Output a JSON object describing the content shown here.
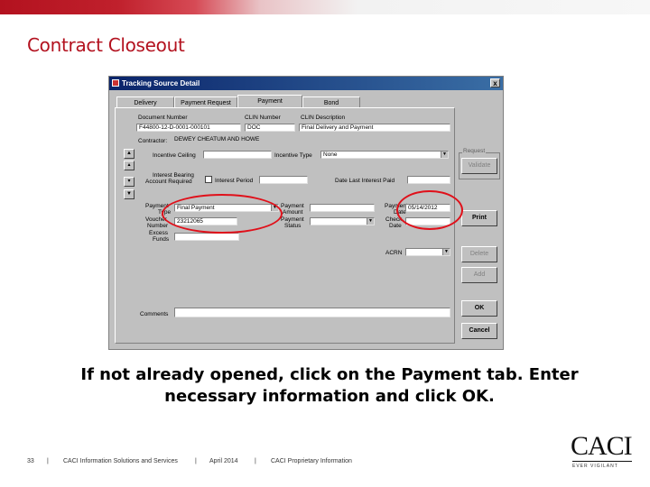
{
  "slide": {
    "title": "Contract Closeout",
    "caption_line1": "If not already opened, click on the Payment tab.  Enter",
    "caption_line2": "necessary information and click OK."
  },
  "footer": {
    "page": "33",
    "sep": "|",
    "company": "CACI Information Solutions and Services",
    "date": "April 2014",
    "notice": "CACI Proprietary Information"
  },
  "logo": {
    "text": "CACI",
    "tagline": "EVER VIGILANT"
  },
  "window": {
    "title": "Tracking Source Detail",
    "close": "x",
    "tabs": [
      "Delivery",
      "Payment Request",
      "Payment",
      "Bond"
    ],
    "active_tab": "Payment"
  },
  "form": {
    "document_number_label": "Document Number",
    "document_number": "F44800-12-D-0001-000101",
    "clin_number_label": "CLIN Number",
    "clin_number": "DOC",
    "clin_description_label": "CLIN Description",
    "clin_description": "Final Delivery and Payment",
    "contractor_label": "Contractor:",
    "contractor": "DEWEY CHEATUM AND HOWE",
    "incentive_ceiling_label": "Incentive Ceiling",
    "incentive_ceiling": "",
    "incentive_type_label": "Incentive Type",
    "incentive_type": "None",
    "interest_bearing_label_1": "Interest Bearing",
    "interest_bearing_label_2": "Account Required",
    "interest_period_label": "Interest Period",
    "interest_period": "",
    "date_last_interest_label": "Date Last Interest Paid",
    "date_last_interest": "",
    "payment_type_label_1": "Payment",
    "payment_type_label_2": "Type",
    "payment_type": "Final Payment",
    "voucher_label_1": "Voucher",
    "voucher_label_2": "Number",
    "voucher": "23212065",
    "excess_label_1": "Excess",
    "excess_label_2": "Funds",
    "excess": "",
    "payment_amount_label_1": "Payment",
    "payment_amount_label_2": "Amount",
    "payment_amount": "",
    "payment_status_label_1": "Payment",
    "payment_status_label_2": "Status",
    "payment_status": "",
    "payment_date_label_1": "Payment",
    "payment_date_label_2": "Date",
    "payment_date": "05/14/2012",
    "check_date_label_1": "Check",
    "check_date_label_2": "Date",
    "check_date": "",
    "acrn_label": "ACRN",
    "acrn": "",
    "comments_label": "Comments",
    "comments": ""
  },
  "buttons": {
    "request_group": "Request",
    "validate": "Validate",
    "print": "Print",
    "delete": "Delete",
    "add": "Add",
    "ok": "OK",
    "cancel": "Cancel"
  },
  "colors": {
    "accent": "#b3121f",
    "highlight_ring": "#e0101a"
  }
}
